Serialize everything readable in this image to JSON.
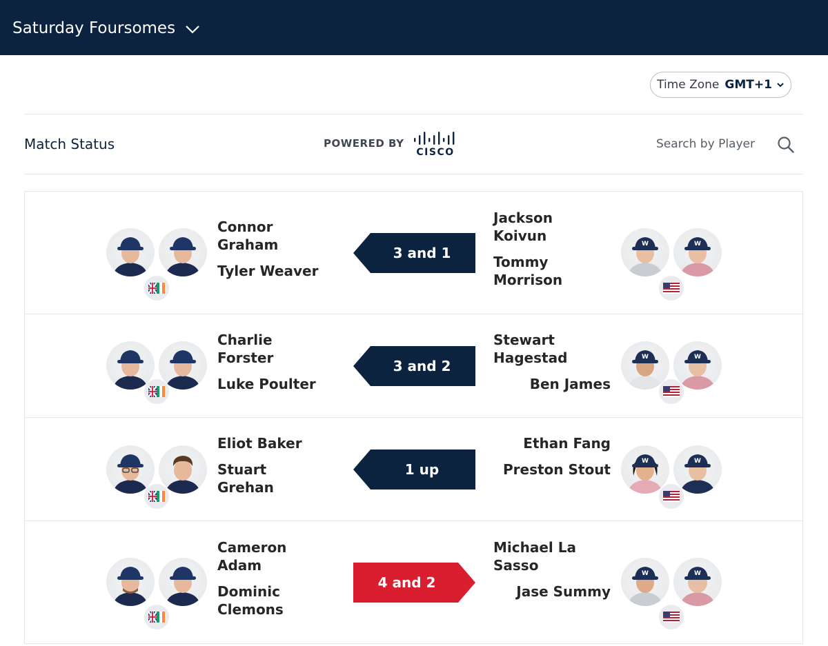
{
  "header": {
    "round_title": "Saturday Foursomes",
    "round_icon": "chevron-down-icon"
  },
  "timezone": {
    "label": "Time Zone",
    "value": "GMT+1"
  },
  "toolbar": {
    "match_status": "Match Status",
    "powered_by": "POWERED BY",
    "sponsor_logo_text": "CISCO",
    "search_placeholder": "Search by Player"
  },
  "colors": {
    "navy": "#0c2340",
    "win_left": "#0c2340",
    "win_right": "#d91f2f"
  },
  "matches": [
    {
      "left_player_1": "Connor\nGraham",
      "left_player_2": "Tyler Weaver",
      "left_team": "GB&I",
      "result": "3 and 1",
      "winner": "left",
      "right_player_1": "Jackson\nKoivun",
      "right_player_2": "Tommy\nMorrison",
      "right_team": "USA"
    },
    {
      "left_player_1": "Charlie\nForster",
      "left_player_2": "Luke Poulter",
      "left_team": "GB&I",
      "result": "3 and 2",
      "winner": "left",
      "right_player_1": "Stewart\nHagestad",
      "right_player_2": "Ben James",
      "right_team": "USA"
    },
    {
      "left_player_1": "Eliot Baker",
      "left_player_2": "Stuart\nGrehan",
      "left_team": "GB&I",
      "result": "1 up",
      "winner": "left",
      "right_player_1": "Ethan Fang",
      "right_player_2": "Preston Stout",
      "right_team": "USA"
    },
    {
      "left_player_1": "Cameron\nAdam",
      "left_player_2": "Dominic\nClemons",
      "left_team": "GB&I",
      "result": "4 and 2",
      "winner": "right",
      "right_player_1": "Michael La\nSasso",
      "right_player_2": "Jase Summy",
      "right_team": "USA"
    }
  ]
}
